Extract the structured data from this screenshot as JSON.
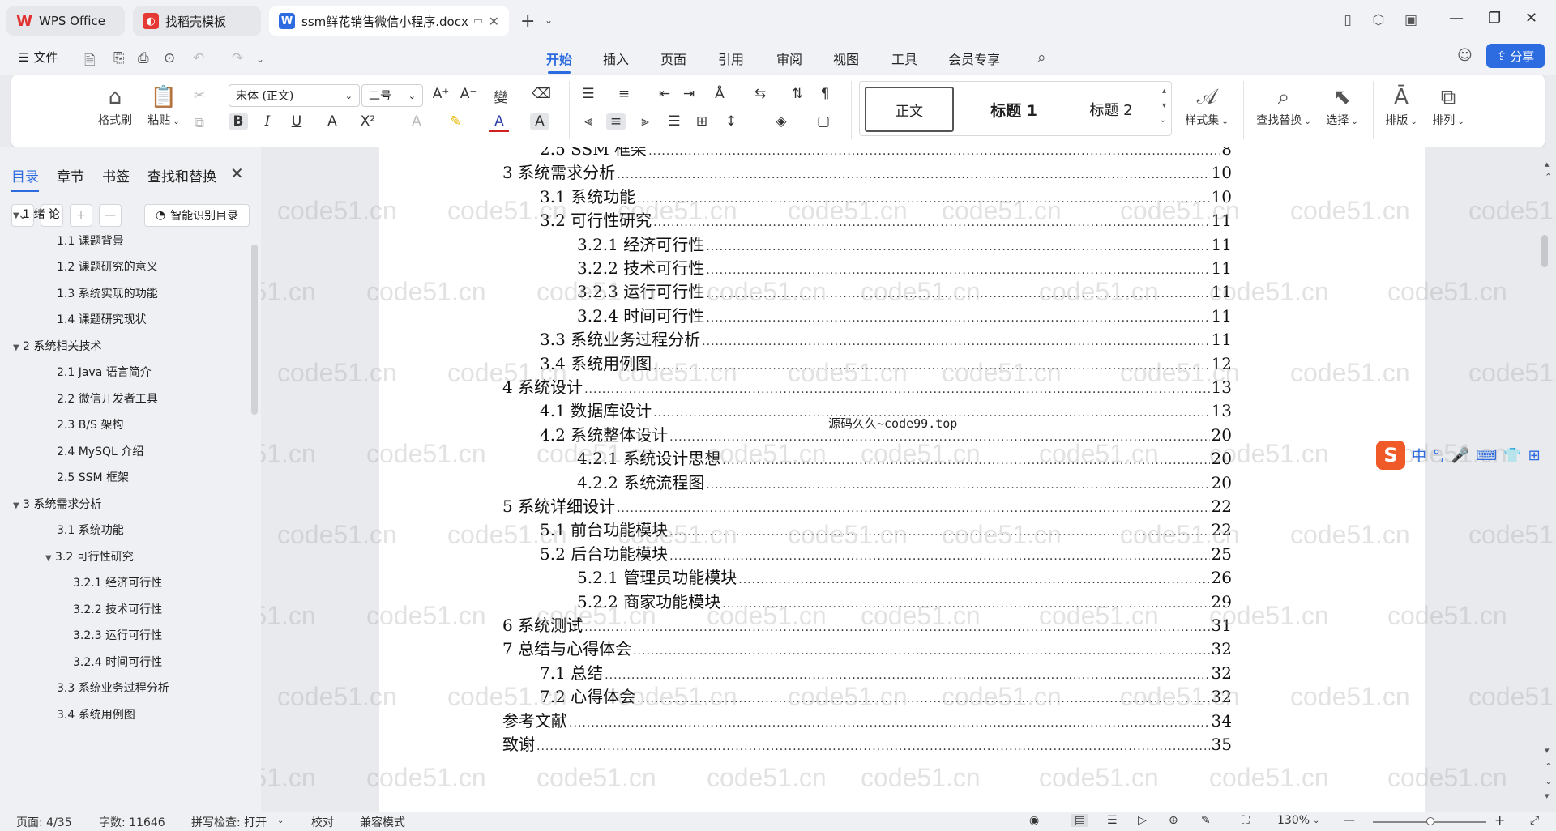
{
  "tabs": {
    "wps": "WPS Office",
    "template": "找稻壳模板",
    "doc": "ssm鲜花销售微信小程序.docx"
  },
  "menu": {
    "file": "文件",
    "items": [
      "开始",
      "插入",
      "页面",
      "引用",
      "审阅",
      "视图",
      "工具",
      "会员专享"
    ],
    "share": "分享"
  },
  "ribbon": {
    "format_painter": "格式刷",
    "paste": "粘贴",
    "font_name": "宋体 (正文)",
    "font_size": "二号",
    "styles": [
      "正文",
      "标题 1",
      "标题 2"
    ],
    "style_set": "样式集",
    "find_replace": "查找替换",
    "select": "选择",
    "layout": "排版",
    "arrange": "排列"
  },
  "nav": {
    "tabs": [
      "目录",
      "章节",
      "书签",
      "查找和替换"
    ],
    "smart_toc": "智能识别目录",
    "items": [
      {
        "label": "1  绪  论",
        "level": 0,
        "expanded": true
      },
      {
        "label": "1.1  课题背景",
        "level": 1
      },
      {
        "label": "1.2  课题研究的意义",
        "level": 1
      },
      {
        "label": "1.3  系统实现的功能",
        "level": 1
      },
      {
        "label": "1.4  课题研究现状",
        "level": 1
      },
      {
        "label": "2 系统相关技术",
        "level": 0,
        "expanded": true
      },
      {
        "label": "2.1 Java 语言简介",
        "level": 1
      },
      {
        "label": "2.2 微信开发者工具",
        "level": 1
      },
      {
        "label": "2.3 B/S 架构",
        "level": 1
      },
      {
        "label": "2.4 MySQL  介绍",
        "level": 1
      },
      {
        "label": "2.5 SSM 框架",
        "level": 1
      },
      {
        "label": "3 系统需求分析",
        "level": 0,
        "expanded": true
      },
      {
        "label": "3.1 系统功能",
        "level": 1
      },
      {
        "label": "3.2 可行性研究",
        "level": 1,
        "expanded": true
      },
      {
        "label": "3.2.1  经济可行性",
        "level": 2
      },
      {
        "label": "3.2.2  技术可行性",
        "level": 2
      },
      {
        "label": "3.2.3  运行可行性",
        "level": 2
      },
      {
        "label": "3.2.4  时间可行性",
        "level": 2
      },
      {
        "label": "3.3 系统业务过程分析",
        "level": 1
      },
      {
        "label": "3.4 系统用例图",
        "level": 1
      }
    ]
  },
  "document": {
    "toc": [
      {
        "text": "2.5 SSM 框架",
        "page": "8",
        "level": 1
      },
      {
        "text": "3 系统需求分析",
        "page": "10",
        "level": 0
      },
      {
        "text": "3.1 系统功能",
        "page": "10",
        "level": 1
      },
      {
        "text": "3.2 可行性研究",
        "page": "11",
        "level": 1
      },
      {
        "text": "3.2.1  经济可行性",
        "page": "11",
        "level": 2
      },
      {
        "text": "3.2.2  技术可行性",
        "page": "11",
        "level": 2
      },
      {
        "text": "3.2.3  运行可行性",
        "page": "11",
        "level": 2
      },
      {
        "text": "3.2.4  时间可行性",
        "page": "11",
        "level": 2
      },
      {
        "text": "3.3 系统业务过程分析",
        "page": "11",
        "level": 1
      },
      {
        "text": "3.4 系统用例图",
        "page": "12",
        "level": 1
      },
      {
        "text": "4 系统设计",
        "page": "13",
        "level": 0
      },
      {
        "text": "4.1 数据库设计",
        "page": "13",
        "level": 1
      },
      {
        "text": "4.2 系统整体设计",
        "page": "20",
        "level": 1
      },
      {
        "text": "4.2.1  系统设计思想",
        "page": "20",
        "level": 2
      },
      {
        "text": "4.2.2 系统流程图",
        "page": "20",
        "level": 2
      },
      {
        "text": "5 系统详细设计",
        "page": "22",
        "level": 0
      },
      {
        "text": "5.1 前台功能模块",
        "page": "22",
        "level": 1
      },
      {
        "text": "5.2 后台功能模块",
        "page": "25",
        "level": 1
      },
      {
        "text": "5.2.1 管理员功能模块",
        "page": "26",
        "level": 2
      },
      {
        "text": "5.2.2 商家功能模块",
        "page": "29",
        "level": 2
      },
      {
        "text": "6 系统测试",
        "page": "31",
        "level": 0
      },
      {
        "text": "7 总结与心得体会",
        "page": "32",
        "level": 0
      },
      {
        "text": "7.1  总结",
        "page": "32",
        "level": 1
      },
      {
        "text": "7.2  心得体会",
        "page": "32",
        "level": 1
      },
      {
        "text": "参考文献",
        "page": "34",
        "level": 0
      },
      {
        "text": "致谢",
        "page": "35",
        "level": 0
      }
    ],
    "stamp": "源码久久~code99.top",
    "watermark": "code51.cn"
  },
  "ime": {
    "lang": "中",
    "punct": "°,"
  },
  "status": {
    "page": "页面: 4/35",
    "words": "字数: 11646",
    "spell": "拼写检查: 打开",
    "proof": "校对",
    "compat": "兼容模式",
    "zoom": "130%"
  },
  "colors": {
    "accent": "#2c6be0",
    "wps_red": "#e0312f"
  }
}
